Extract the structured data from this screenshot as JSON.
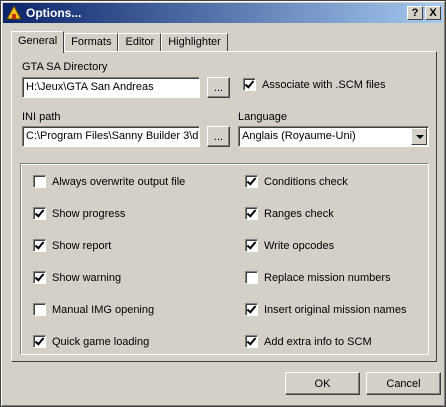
{
  "window": {
    "title": "Options...",
    "help_label": "?",
    "close_label": "X"
  },
  "tabs": [
    {
      "label": "General",
      "active": true
    },
    {
      "label": "Formats",
      "active": false
    },
    {
      "label": "Editor",
      "active": false
    },
    {
      "label": "Highlighter",
      "active": false
    }
  ],
  "general": {
    "gta_dir_label": "GTA SA Directory",
    "gta_dir_value": "H:\\Jeux\\GTA San Andreas",
    "browse_label": "...",
    "associate_label": "Associate with .SCM files",
    "associate_checked": true,
    "ini_label": "INI path",
    "ini_value": "C:\\Program Files\\Sanny Builder 3\\d",
    "language_label": "Language",
    "language_value": "Anglais (Royaume-Uni)"
  },
  "options_left": [
    {
      "label": "Always overwrite output file",
      "checked": false
    },
    {
      "label": "Show progress",
      "checked": true
    },
    {
      "label": "Show report",
      "checked": true
    },
    {
      "label": "Show warning",
      "checked": true
    },
    {
      "label": "Manual IMG opening",
      "checked": false
    },
    {
      "label": "Quick game loading",
      "checked": true
    }
  ],
  "options_right": [
    {
      "label": "Conditions check",
      "checked": true
    },
    {
      "label": "Ranges check",
      "checked": true
    },
    {
      "label": "Write opcodes",
      "checked": true
    },
    {
      "label": "Replace mission numbers",
      "checked": false
    },
    {
      "label": "Insert original mission names",
      "checked": true
    },
    {
      "label": "Add extra info to SCM",
      "checked": true
    }
  ],
  "footer": {
    "ok_label": "OK",
    "cancel_label": "Cancel"
  },
  "colors": {
    "titlebar_start": "#0a246a",
    "titlebar_end": "#a6caf0",
    "face": "#d4d0c8"
  }
}
